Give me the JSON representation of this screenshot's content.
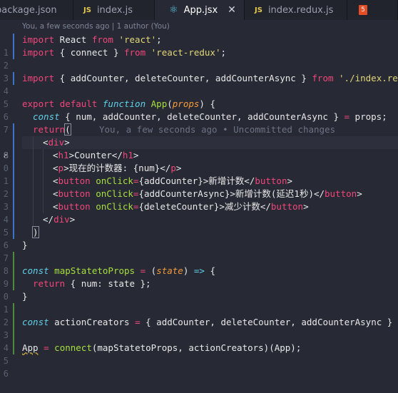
{
  "tabs": [
    {
      "label": "package.json",
      "icon": "json-file-icon",
      "icon_text": "",
      "active": false
    },
    {
      "label": "index.js",
      "icon": "js-file-icon",
      "icon_text": "JS",
      "active": false
    },
    {
      "label": "App.jsx",
      "icon": "react-file-icon",
      "icon_text": "⚛",
      "active": true,
      "close": "✕"
    },
    {
      "label": "index.redux.js",
      "icon": "js-file-icon",
      "icon_text": "JS",
      "active": false
    },
    {
      "label": "",
      "icon": "html5-file-icon",
      "icon_text": "5",
      "active": false
    }
  ],
  "blame_header": "You, a few seconds ago | 1 author (You)",
  "inline_blame": "You, a few seconds ago • Uncommitted changes",
  "line_numbers": [
    "1",
    "2",
    "3",
    "4",
    "5",
    "6",
    "7",
    "8",
    "9",
    "0",
    "1",
    "2",
    "3",
    "4",
    "5",
    "6",
    "7",
    "8",
    "9",
    "0",
    "1",
    "2",
    "3",
    "4",
    "5",
    "6"
  ],
  "current_line_index": 7,
  "code": {
    "l1": [
      "import",
      " React ",
      "from",
      " ",
      "'react'",
      ";"
    ],
    "l2": [
      "import",
      " { connect } ",
      "from",
      " ",
      "'react-redux'",
      ";"
    ],
    "l4": [
      "import",
      " { addCounter, deleteCounter, addCounterAsync } ",
      "from",
      " ",
      "'./index.redux"
    ],
    "l6": [
      "export",
      " ",
      "default",
      " ",
      "function",
      " ",
      "App",
      "(",
      "props",
      ") {"
    ],
    "l7": [
      "const",
      " { num, addCounter, deleteCounter, addCounterAsync } ",
      "=",
      " props;"
    ],
    "l8": [
      "return",
      "("
    ],
    "l9": [
      "<",
      "div",
      ">"
    ],
    "l10": [
      "<",
      "h1",
      ">Counter</",
      "h1",
      ">"
    ],
    "l11": [
      "<",
      "p",
      ">现在的计数器: {num}</",
      "p",
      ">"
    ],
    "l12": [
      "<",
      "button",
      " ",
      "onClick",
      "=",
      "{addCounter}",
      ">新增计数</",
      "button",
      ">"
    ],
    "l13": [
      "<",
      "button",
      " ",
      "onClick",
      "=",
      "{addCounterAsync}",
      ">新增计数(延迟1秒)</",
      "button",
      ">"
    ],
    "l14": [
      "<",
      "button",
      " ",
      "onClick",
      "=",
      "{deleteCounter}",
      ">减少计数</",
      "button",
      ">"
    ],
    "l15": [
      "</",
      "div",
      ">"
    ],
    "l16": [
      ")"
    ],
    "l17": [
      "}"
    ],
    "l19": [
      "const",
      " ",
      "mapStatetoProps",
      " ",
      "=",
      " (",
      "state",
      ") ",
      "=>",
      " {"
    ],
    "l20": [
      "return",
      " { num: state };"
    ],
    "l21": [
      "}"
    ],
    "l23": [
      "const",
      " actionCreators ",
      "=",
      " { addCounter, deleteCounter, addCounterAsync }"
    ],
    "l25": [
      "App",
      " ",
      "=",
      " ",
      "connect",
      "(mapStatetoProps, actionCreators)(App);"
    ]
  },
  "colors": {
    "background": "#272a35",
    "keyword": "#f2457a",
    "function": "#a7df3c",
    "string": "#e3d777",
    "param": "#f59a3a",
    "type": "#5fd0e8"
  }
}
